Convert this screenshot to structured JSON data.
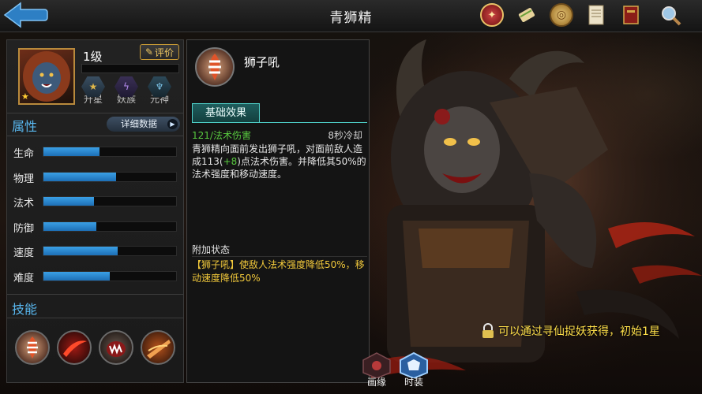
{
  "header": {
    "title": "青狮精",
    "icons": [
      "back-arrow-icon",
      "seal-icon",
      "scroll-icon",
      "coin-icon",
      "document-icon",
      "book-icon",
      "search-icon"
    ]
  },
  "hero": {
    "level": "1级",
    "rate_button": "评价",
    "badges": [
      {
        "label": "升星",
        "icon": "star-badge-icon"
      },
      {
        "label": "妖族",
        "icon": "demon-badge-icon"
      },
      {
        "label": "元神",
        "icon": "spirit-badge-icon"
      }
    ]
  },
  "attributes": {
    "title": "属性",
    "detail_button": "详细数据",
    "stats": [
      {
        "label": "生命",
        "value": 0.42
      },
      {
        "label": "物理",
        "value": 0.55
      },
      {
        "label": "法术",
        "value": 0.38
      },
      {
        "label": "防御",
        "value": 0.4
      },
      {
        "label": "速度",
        "value": 0.56
      },
      {
        "label": "难度",
        "value": 0.5
      }
    ]
  },
  "skills": {
    "title": "技能",
    "items": [
      "skill-lion-roar-icon",
      "skill-red-slash-icon",
      "skill-fang-icon",
      "skill-blade-icon"
    ]
  },
  "skill_detail": {
    "name": "狮子吼",
    "tab": "基础效果",
    "damage": "121/法术伤害",
    "cooldown": "8秒冷却",
    "desc_pre": "青狮精向面前发出狮子吼，对面前敌人造成113(",
    "desc_bonus": "+8",
    "desc_post": ")点法术伤害。并降低其50%的法术强度和移动速度。",
    "extra_title": "附加状态",
    "extra_text": "【狮子吼】使敌人法术强度降低50%，移动速度降低50%"
  },
  "bottom_tabs": [
    "画缘",
    "时装"
  ],
  "unlock_message": "可以通过寻仙捉妖获得，初始1星",
  "colors": {
    "accent_blue": "#59b8f0",
    "bar_fill": "#2a86d0",
    "green": "#58c93f",
    "gold": "#f2c93b",
    "teal": "#4fd0c9"
  }
}
